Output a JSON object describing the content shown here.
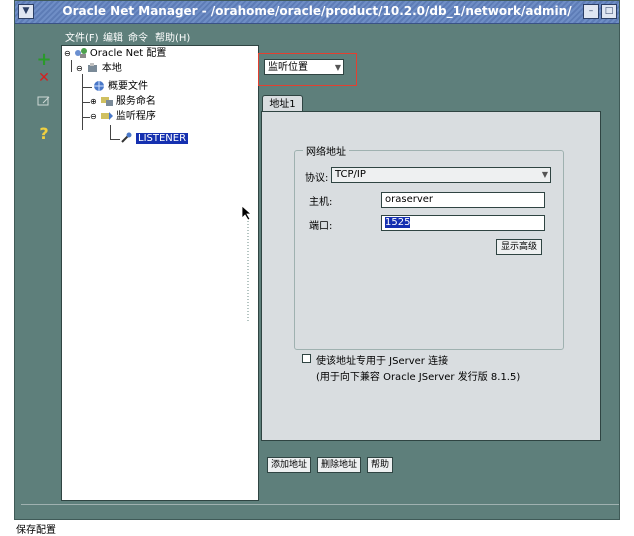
{
  "window": {
    "title": "Oracle Net Manager - /orahome/oracle/product/10.2.0/db_1/network/admin/"
  },
  "menu": {
    "file": "文件(F)",
    "edit": "编辑",
    "command": "命令",
    "help": "帮助(H)"
  },
  "toolbar": {
    "add_icon": "+",
    "delete_icon": "✕",
    "help_icon": "?"
  },
  "tree": {
    "root": "Oracle Net 配置",
    "local": "本地",
    "profile": "概要文件",
    "naming": "服务命名",
    "listeners": "监听程序",
    "listener": "LISTENER"
  },
  "main": {
    "view_select": "监听位置",
    "tab_label": "地址1",
    "group_title": "网络地址",
    "protocol_label": "协议:",
    "protocol_value": "TCP/IP",
    "host_label": "主机:",
    "host_value": "oraserver",
    "port_label": "端口:",
    "port_value": "1525",
    "advanced_button": "显示高级",
    "jserver_checkbox": "使该地址专用于 JServer 连接",
    "jserver_note": "(用于向下兼容 Oracle JServer 发行版 8.1.5)"
  },
  "buttons": {
    "add_address": "添加地址",
    "delete_address": "删除地址",
    "help": "帮助"
  },
  "status": {
    "text": "保存配置"
  }
}
